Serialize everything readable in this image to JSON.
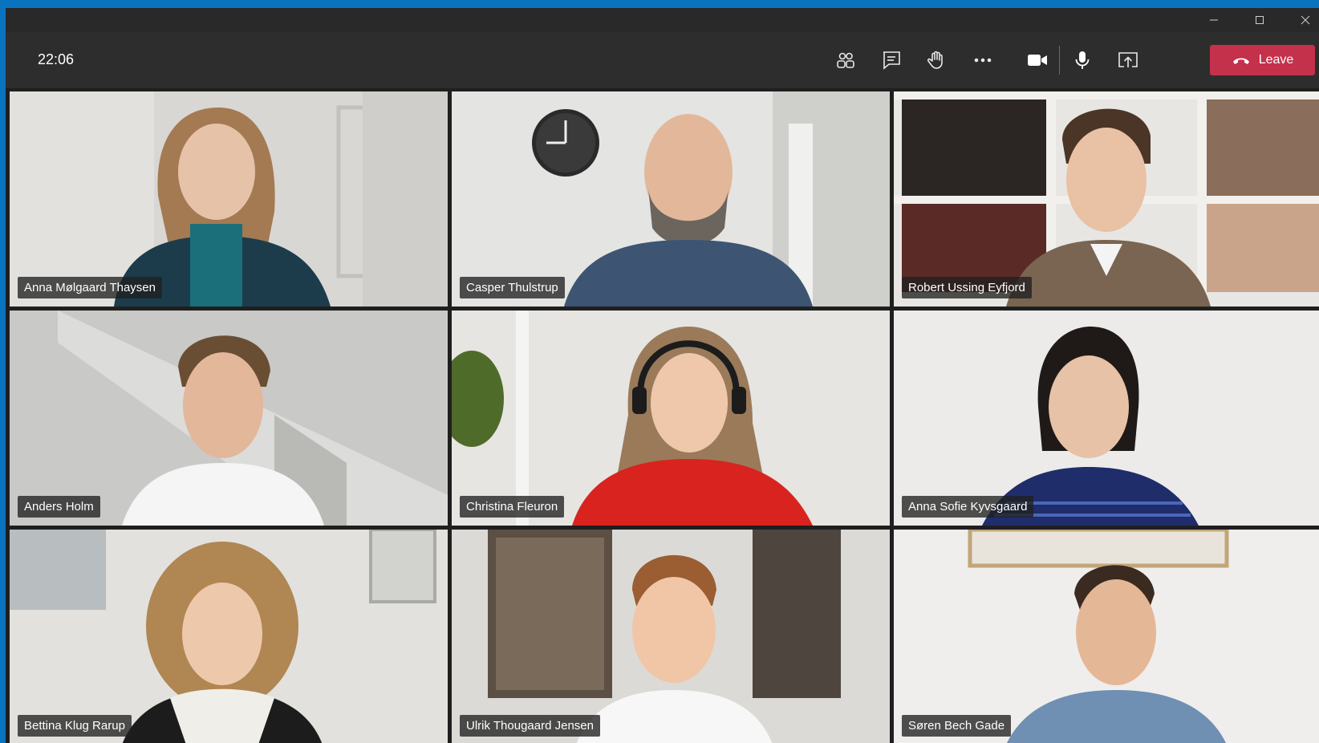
{
  "window": {
    "controls": {
      "minimize": "minimize-icon",
      "maximize": "maximize-icon",
      "close": "close-icon"
    }
  },
  "toolbar": {
    "time": "22:06",
    "icons": [
      "participants-icon",
      "chat-icon",
      "raise-hand-icon",
      "more-options-icon",
      "camera-icon",
      "microphone-icon",
      "share-screen-icon",
      "phone-hangup-icon"
    ],
    "leave_label": "Leave",
    "leave_color": "#c4314b"
  },
  "participants": [
    {
      "name": "Anna Mølgaard Thaysen"
    },
    {
      "name": "Casper Thulstrup"
    },
    {
      "name": "Robert Ussing Eyfjord"
    },
    {
      "name": "Anders Holm"
    },
    {
      "name": "Christina Fleuron"
    },
    {
      "name": "Anna Sofie Kyvsgaard"
    },
    {
      "name": "Bettina Klug Rarup"
    },
    {
      "name": "Ulrik Thougaard Jensen"
    },
    {
      "name": "Søren Bech Gade"
    }
  ]
}
